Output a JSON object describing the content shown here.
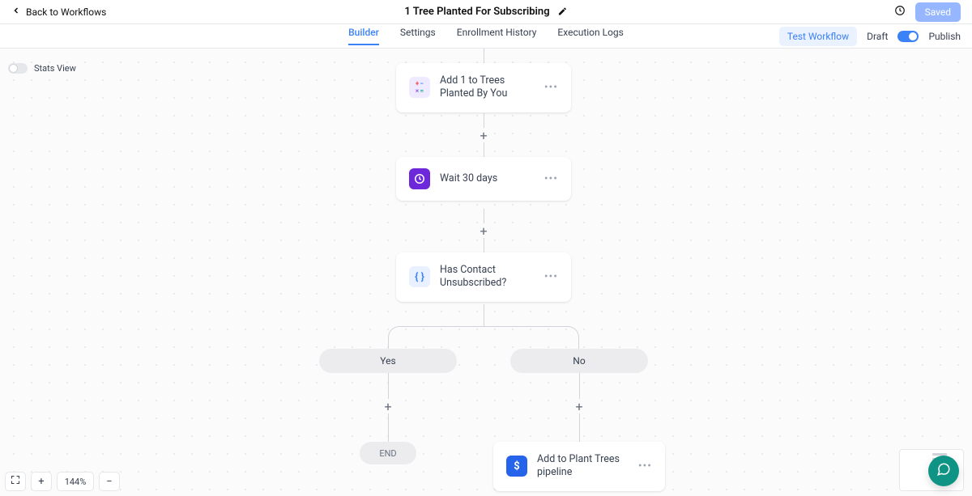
{
  "header": {
    "back_label": "Back to Workflows",
    "title": "1 Tree Planted For Subscribing",
    "saved_label": "Saved"
  },
  "tabs": {
    "items": [
      "Builder",
      "Settings",
      "Enrollment History",
      "Execution Logs"
    ],
    "active_index": 0,
    "test_label": "Test Workflow",
    "draft_label": "Draft",
    "publish_label": "Publish",
    "publish_on": true
  },
  "stats_view": {
    "label": "Stats View",
    "on": false
  },
  "nodes": {
    "math": {
      "label": "Add 1 to Trees Planted By You"
    },
    "wait": {
      "label": "Wait 30 days"
    },
    "cond": {
      "label": "Has Contact Unsubscribed?"
    },
    "branches": {
      "yes": "Yes",
      "no": "No"
    },
    "end": {
      "label": "END"
    },
    "pipeline": {
      "label": "Add to Plant Trees pipeline"
    }
  },
  "zoom": {
    "value": "144%"
  }
}
